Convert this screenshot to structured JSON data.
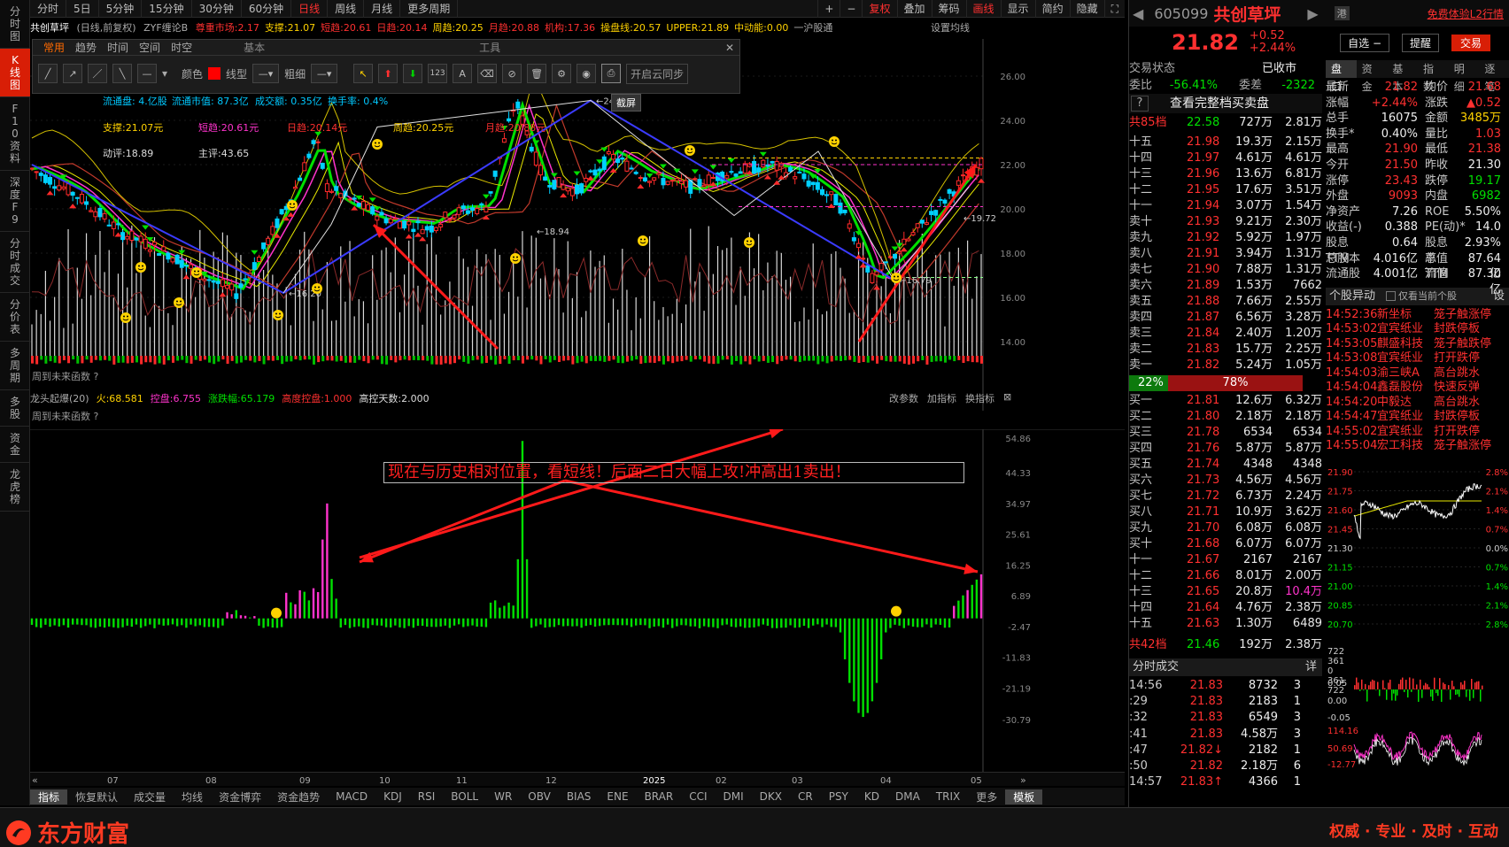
{
  "left_strip": [
    "分时图",
    "K线图",
    "F10资料",
    "深度F9",
    "分时成交",
    "分价表",
    "多周期",
    "多股",
    "资金",
    "龙虎榜"
  ],
  "period_tabs": [
    "分时",
    "5日",
    "5分钟",
    "15分钟",
    "30分钟",
    "60分钟",
    "日线",
    "周线",
    "月线",
    "更多周期"
  ],
  "active_period": "日线",
  "toolbar_right": [
    "+",
    "−",
    "复权",
    "叠加",
    "筹码",
    "画线",
    "显示",
    "简约",
    "隐藏"
  ],
  "info": {
    "name": "共创草坪",
    "mode": "(日线,前复权)",
    "formula": "ZYF缠论B",
    "items": [
      "尊重市场:2.17",
      "支撑:21.07",
      "短趋:20.61",
      "日趋:20.14",
      "周趋:20.25",
      "月趋:20.88",
      "机构:17.36",
      "操盘线:20.57",
      "UPPER:21.89",
      "中动能:0.00",
      "一沪股通"
    ],
    "settings": "设置均线"
  },
  "tool_panel": {
    "tabs": [
      "常用",
      "趋势",
      "时间",
      "空间",
      "时空"
    ],
    "group1": "基本",
    "group2": "工具",
    "color_label": "颜色",
    "linetype_label": "线型",
    "thickness_label": "粗细",
    "sync_label": "开启云同步",
    "tooltip": "截屏"
  },
  "overlay_text": {
    "float_cap": "流通盘: 4.亿股",
    "float_val": "流通市值: 87.3亿",
    "turnover": "成交额: 0.35亿",
    "rate": "换手率: 0.4%",
    "support": "支撑:21.07元",
    "short": "短趋:20.61元",
    "day": "日趋:20.14元",
    "week": "周趋:20.25元",
    "month": "月趋:20.88元",
    "momentum": "动评:18.89",
    "main": "主评:43.65",
    "future_fn": "周到未来函数 ?"
  },
  "main_y_ticks": [
    "26.00",
    "24.00",
    "22.00",
    "20.00",
    "18.00",
    "16.00",
    "14.00"
  ],
  "sub_info": {
    "name": "龙头起爆(20)",
    "items": [
      "火:68.581",
      "控盘:6.755",
      "涨跌幅:65.179",
      "高度控盘:1.000",
      "高控天数:2.000"
    ],
    "right_btns": [
      "改参数",
      "加指标",
      "换指标"
    ],
    "future_fn": "周到未来函数 ?"
  },
  "sub_y_ticks": [
    "54.86",
    "44.33",
    "34.97",
    "25.61",
    "16.25",
    "6.89",
    "-2.47",
    "-11.83",
    "-21.19",
    "-30.79"
  ],
  "annotation": "现在与历史相对位置，看短线！后面二日大幅上攻!冲高出1卖出！",
  "date_ticks": [
    "07",
    "08",
    "09",
    "10",
    "11",
    "12",
    "2025",
    "02",
    "03",
    "04",
    "05"
  ],
  "indicators": [
    "指标",
    "恢复默认",
    "成交量",
    "均线",
    "资金博弈",
    "资金趋势",
    "MACD",
    "KDJ",
    "RSI",
    "BOLL",
    "WR",
    "OBV",
    "BIAS",
    "ENE",
    "BRAR",
    "CCI",
    "DMI",
    "DKX",
    "CR",
    "PSY",
    "KD",
    "DMA",
    "TRIX",
    "更多",
    "模板"
  ],
  "footer": {
    "logo": "东方财富",
    "slogan": "权威 · 专业 · 及时 · 互动"
  },
  "right": {
    "code": "605099",
    "name": "共创草坪",
    "promo": "免费体验L2行情",
    "price": "21.82",
    "change": "+0.52",
    "pct": "+2.44%",
    "buttons": [
      "自选 −",
      "提醒",
      "交易"
    ],
    "status_label": "交易状态",
    "status": "已收市",
    "weibi_label": "委比",
    "weibi": "-56.41%",
    "weicha_label": "委差",
    "weicha": "-2322",
    "full_book": "查看完整档买卖盘",
    "sell_total": {
      "label": "共85档",
      "price": "22.58",
      "vol": "727万",
      "amt": "2.81万"
    },
    "asks": [
      {
        "l": "十五",
        "p": "21.98",
        "v": "19.3万",
        "c": "2.15万"
      },
      {
        "l": "十四",
        "p": "21.97",
        "v": "4.61万",
        "c": "4.61万"
      },
      {
        "l": "十三",
        "p": "21.96",
        "v": "13.6万",
        "c": "6.81万"
      },
      {
        "l": "十二",
        "p": "21.95",
        "v": "17.6万",
        "c": "3.51万"
      },
      {
        "l": "十一",
        "p": "21.94",
        "v": "3.07万",
        "c": "1.54万"
      },
      {
        "l": "卖十",
        "p": "21.93",
        "v": "9.21万",
        "c": "2.30万"
      },
      {
        "l": "卖九",
        "p": "21.92",
        "v": "5.92万",
        "c": "1.97万"
      },
      {
        "l": "卖八",
        "p": "21.91",
        "v": "3.94万",
        "c": "1.31万"
      },
      {
        "l": "卖七",
        "p": "21.90",
        "v": "7.88万",
        "c": "1.31万"
      },
      {
        "l": "卖六",
        "p": "21.89",
        "v": "1.53万",
        "c": "7662"
      },
      {
        "l": "卖五",
        "p": "21.88",
        "v": "7.66万",
        "c": "2.55万"
      },
      {
        "l": "卖四",
        "p": "21.87",
        "v": "6.56万",
        "c": "3.28万"
      },
      {
        "l": "卖三",
        "p": "21.84",
        "v": "2.40万",
        "c": "1.20万"
      },
      {
        "l": "卖二",
        "p": "21.83",
        "v": "15.7万",
        "c": "2.25万"
      },
      {
        "l": "卖一",
        "p": "21.82",
        "v": "5.24万",
        "c": "1.05万"
      }
    ],
    "ratio_sell": "22%",
    "ratio_buy": "78%",
    "bids": [
      {
        "l": "买一",
        "p": "21.81",
        "v": "12.6万",
        "c": "6.32万"
      },
      {
        "l": "买二",
        "p": "21.80",
        "v": "2.18万",
        "c": "2.18万"
      },
      {
        "l": "买三",
        "p": "21.78",
        "v": "6534",
        "c": "6534"
      },
      {
        "l": "买四",
        "p": "21.76",
        "v": "5.87万",
        "c": "5.87万"
      },
      {
        "l": "买五",
        "p": "21.74",
        "v": "4348",
        "c": "4348"
      },
      {
        "l": "买六",
        "p": "21.73",
        "v": "4.56万",
        "c": "4.56万"
      },
      {
        "l": "买七",
        "p": "21.72",
        "v": "6.73万",
        "c": "2.24万"
      },
      {
        "l": "买八",
        "p": "21.71",
        "v": "10.9万",
        "c": "3.62万"
      },
      {
        "l": "买九",
        "p": "21.70",
        "v": "6.08万",
        "c": "6.08万"
      },
      {
        "l": "买十",
        "p": "21.68",
        "v": "6.07万",
        "c": "6.07万"
      },
      {
        "l": "十一",
        "p": "21.67",
        "v": "2167",
        "c": "2167"
      },
      {
        "l": "十二",
        "p": "21.66",
        "v": "8.01万",
        "c": "2.00万"
      },
      {
        "l": "十三",
        "p": "21.65",
        "v": "20.8万",
        "c": "10.4万"
      },
      {
        "l": "十四",
        "p": "21.64",
        "v": "4.76万",
        "c": "2.38万"
      },
      {
        "l": "十五",
        "p": "21.63",
        "v": "1.30万",
        "c": "6489"
      }
    ],
    "buy_total": {
      "label": "共42档",
      "price": "21.46",
      "vol": "192万",
      "amt": "2.38万"
    },
    "trades_title": "分时成交",
    "trades_more": "详",
    "trades": [
      {
        "t": "14:56",
        "p": "21.83",
        "v": "8732",
        "n": "3"
      },
      {
        "t": ":29",
        "p": "21.83",
        "v": "2183",
        "n": "1"
      },
      {
        "t": ":32",
        "p": "21.83",
        "v": "6549",
        "n": "3"
      },
      {
        "t": ":41",
        "p": "21.83",
        "v": "4.58万",
        "n": "3"
      },
      {
        "t": ":47",
        "p": "21.82↓",
        "v": "2182",
        "n": "1"
      },
      {
        "t": ":50",
        "p": "21.82",
        "v": "2.18万",
        "n": "6"
      },
      {
        "t": "14:57",
        "p": "21.83↑",
        "v": "4366",
        "n": "1"
      }
    ],
    "quote_tabs": [
      "盘口",
      "资金",
      "基本",
      "指数",
      "明细",
      "逐笔"
    ],
    "quote": [
      {
        "k": "最新",
        "v": "21.82",
        "c": "red",
        "k2": "均价",
        "v2": "21.68",
        "c2": "red"
      },
      {
        "k": "涨幅",
        "v": "+2.44%",
        "c": "red",
        "k2": "涨跌",
        "v2": "▲0.52",
        "c2": "red"
      },
      {
        "k": "总手",
        "v": "16075",
        "c": "white",
        "k2": "金额",
        "v2": "3485万",
        "c2": "yellow"
      },
      {
        "k": "换手*",
        "v": "0.40%",
        "c": "white",
        "k2": "量比",
        "v2": "1.03",
        "c2": "red"
      },
      {
        "k": "最高",
        "v": "21.90",
        "c": "red",
        "k2": "最低",
        "v2": "21.38",
        "c2": "red"
      },
      {
        "k": "今开",
        "v": "21.50",
        "c": "red",
        "k2": "昨收",
        "v2": "21.30",
        "c2": "white"
      },
      {
        "k": "涨停",
        "v": "23.43",
        "c": "red",
        "k2": "跌停",
        "v2": "19.17",
        "c2": "green"
      },
      {
        "k": "外盘",
        "v": "9093",
        "c": "red",
        "k2": "内盘",
        "v2": "6982",
        "c2": "green"
      },
      {
        "k": "净资产",
        "v": "7.26",
        "c": "white",
        "k2": "ROE",
        "v2": "5.50%",
        "c2": "white"
      },
      {
        "k": "收益(-)",
        "v": "0.388",
        "c": "white",
        "k2": "PE(动)*",
        "v2": "14.0",
        "c2": "white"
      },
      {
        "k": "股息TTM",
        "v": "0.64",
        "c": "white",
        "k2": "股息率TTM",
        "v2": "2.93%",
        "c2": "white"
      },
      {
        "k": "总股本",
        "v": "4.016亿",
        "c": "white",
        "k2": "总值",
        "v2": "87.64亿",
        "c2": "white"
      },
      {
        "k": "流通股",
        "v": "4.001亿",
        "c": "white",
        "k2": "流值",
        "v2": "87.30亿",
        "c2": "white"
      }
    ],
    "alerts_title": "个股异动",
    "alerts_filter": "仅看当前个股",
    "alerts_settings": "设",
    "alerts": [
      {
        "t": "14:52:36",
        "n": "新坐标",
        "e": "笼子触涨停"
      },
      {
        "t": "14:53:02",
        "n": "宜宾纸业",
        "e": "封跌停板"
      },
      {
        "t": "14:53:05",
        "n": "麒盛科技",
        "e": "笼子触跌停"
      },
      {
        "t": "14:53:08",
        "n": "宜宾纸业",
        "e": "打开跌停"
      },
      {
        "t": "14:54:03",
        "n": "渝三峡A",
        "e": "高台跳水"
      },
      {
        "t": "14:54:04",
        "n": "鑫磊股份",
        "e": "快速反弹"
      },
      {
        "t": "14:54:20",
        "n": "中毅达",
        "e": "高台跳水"
      },
      {
        "t": "14:54:47",
        "n": "宜宾纸业",
        "e": "封跌停板"
      },
      {
        "t": "14:55:02",
        "n": "宜宾纸业",
        "e": "打开跌停"
      },
      {
        "t": "14:55:04",
        "n": "宏工科技",
        "e": "笼子触涨停"
      }
    ],
    "mini_left_ticks": [
      "21.90",
      "21.75",
      "21.60",
      "21.45",
      "21.30",
      "21.15",
      "21.00",
      "20.85",
      "20.70"
    ],
    "mini_right_ticks": [
      "2.8%",
      "2.1%",
      "1.4%",
      "0.7%",
      "0.0%",
      "0.7%",
      "1.4%",
      "2.1%",
      "2.8%"
    ],
    "mini_vol_ticks": [
      "722",
      "361",
      "0",
      "361",
      "722"
    ],
    "mini_ind_ticks": [
      "0.05",
      "0.00",
      "-0.05",
      "114.16",
      "50.69",
      "-12.77"
    ]
  }
}
